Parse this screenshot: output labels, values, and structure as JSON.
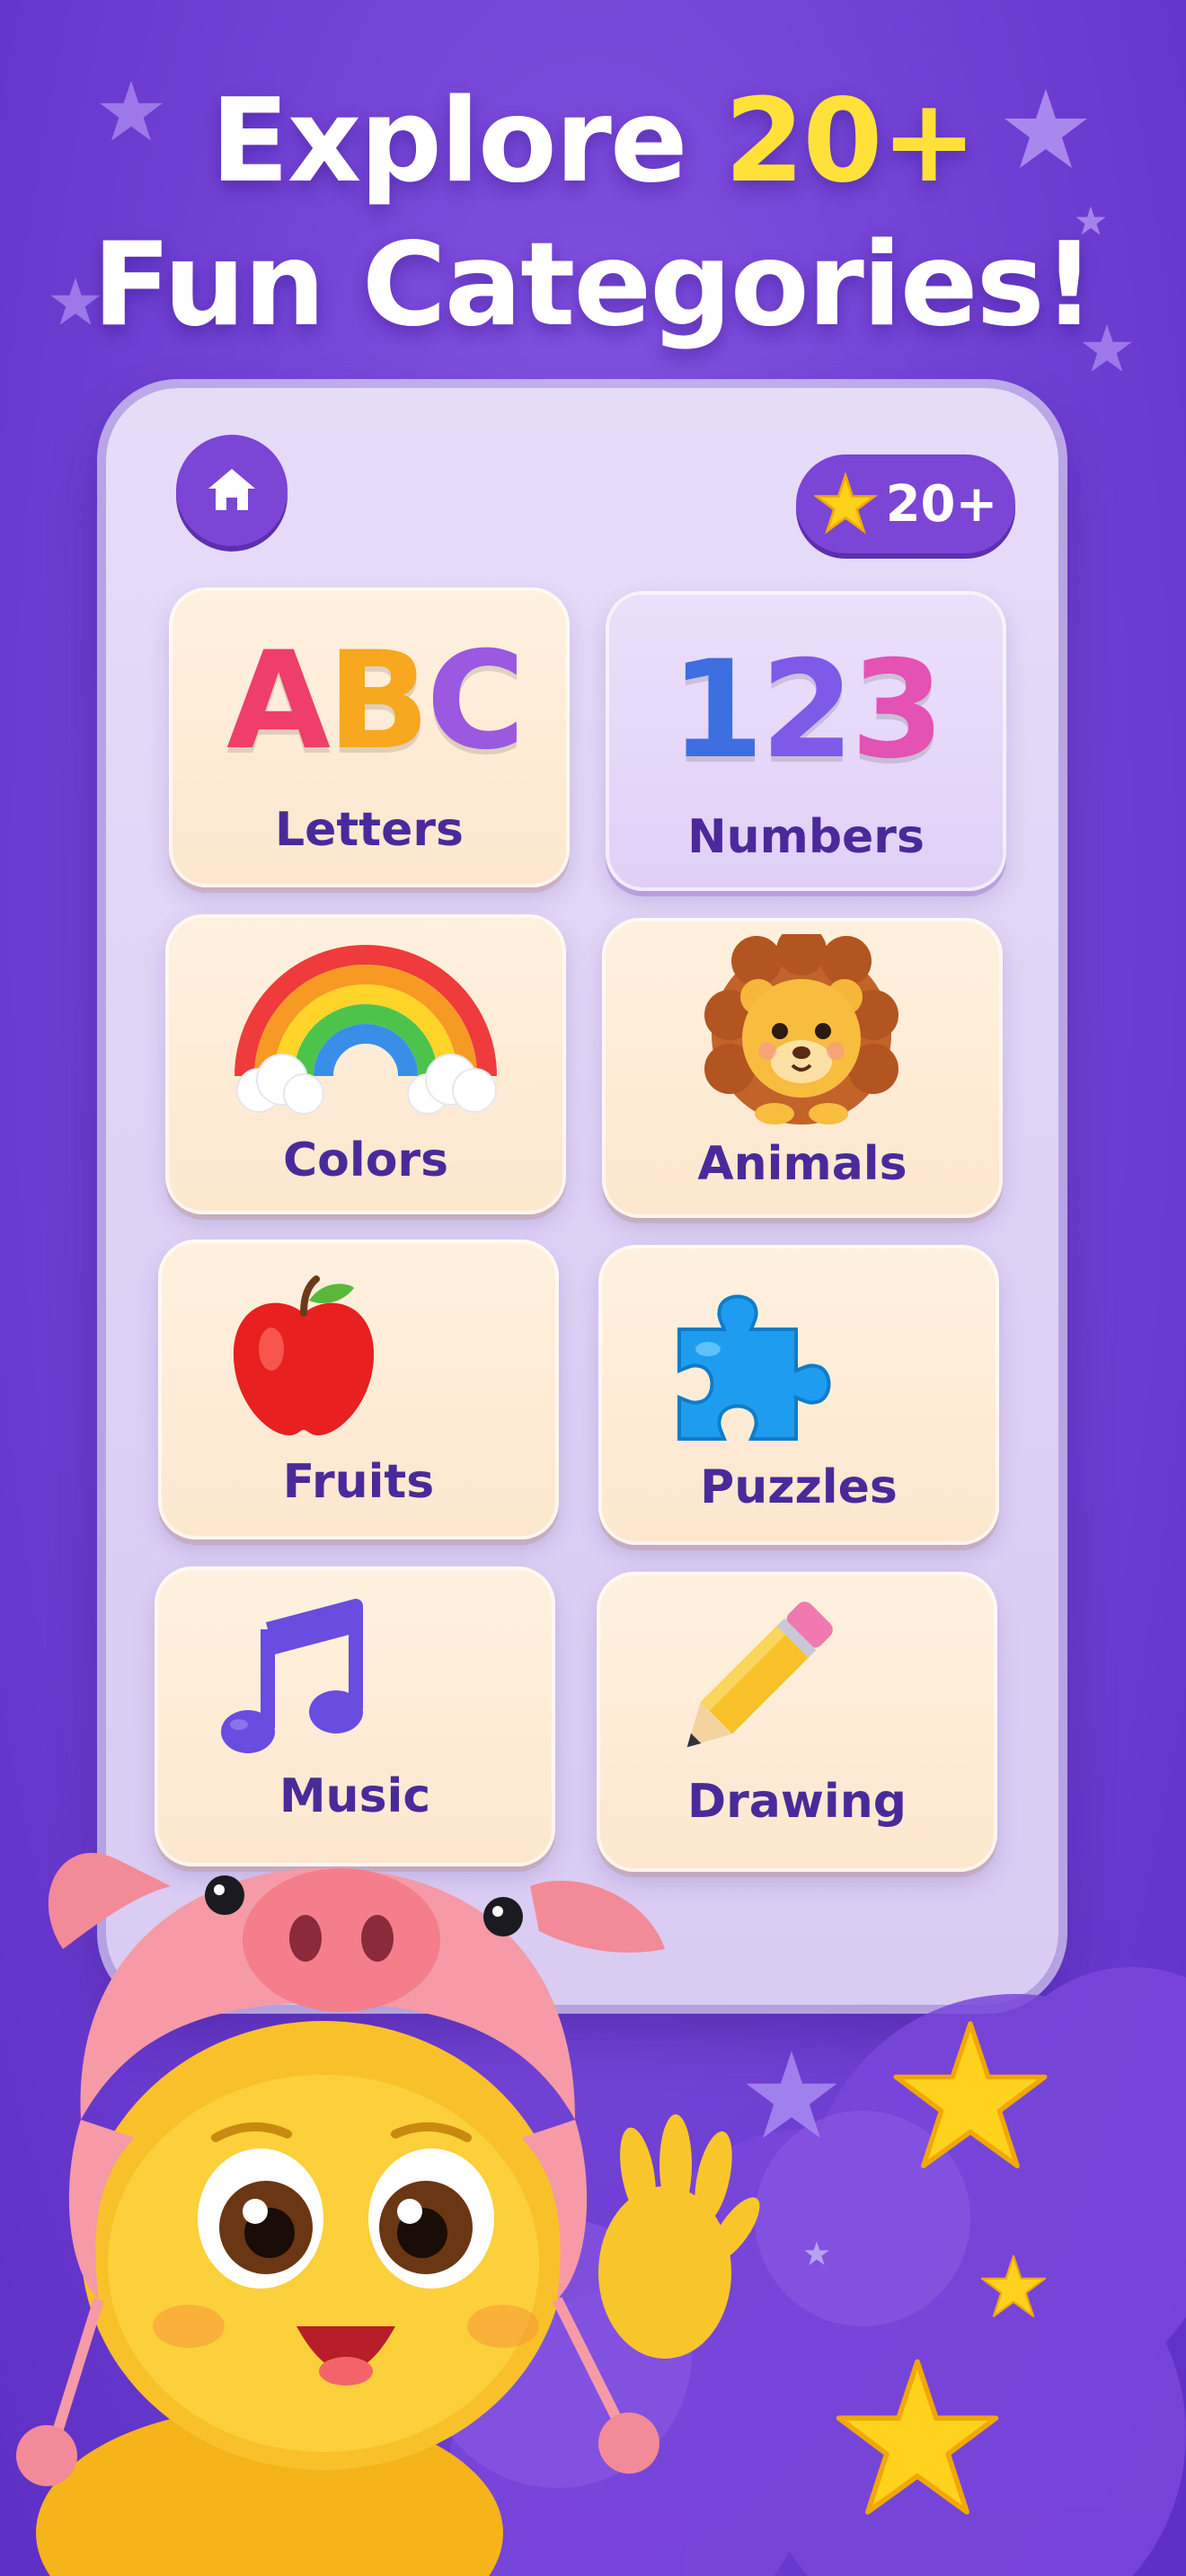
{
  "headline": {
    "line1_prefix": "Explore ",
    "line1_accent": "20+",
    "line2": "Fun Categories!"
  },
  "topbar": {
    "home_icon": "home-icon",
    "stars_icon": "star-icon",
    "stars_count": "20+"
  },
  "tiles": {
    "letters": {
      "label": "Letters",
      "art": [
        "A",
        "B",
        "C"
      ]
    },
    "numbers": {
      "label": "Numbers",
      "art": [
        "1",
        "2",
        "3"
      ]
    },
    "colors": {
      "label": "Colors",
      "icon": "rainbow-icon"
    },
    "animals": {
      "label": "Animals",
      "icon": "lion-icon"
    },
    "fruits": {
      "label": "Fruits",
      "icon": "apple-icon"
    },
    "puzzles": {
      "label": "Puzzles",
      "icon": "puzzle-piece-icon"
    },
    "music": {
      "label": "Music",
      "icon": "music-note-icon"
    },
    "drawing": {
      "label": "Drawing",
      "icon": "pencil-icon"
    }
  },
  "colors": {
    "background": "#7344d6",
    "accent_yellow": "#ffe13a",
    "button_purple": "#7b45d6",
    "label_text": "#4a2a9a"
  }
}
